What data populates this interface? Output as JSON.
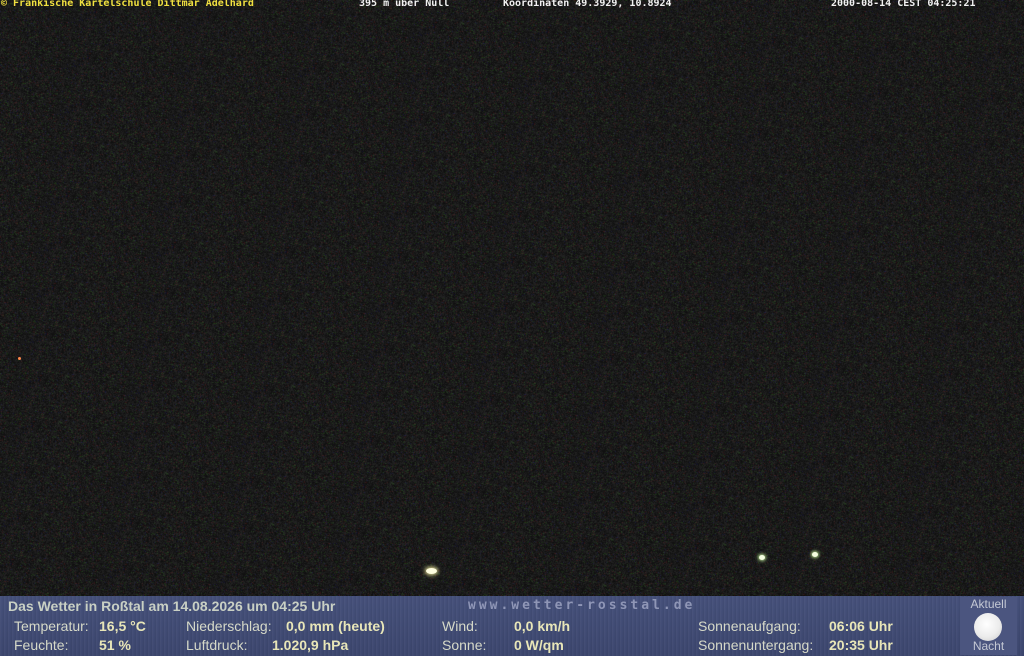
{
  "top_bar": {
    "copyright": "© Fränkische Kartelschule Dittmar Adelhard",
    "altitude": "395 m über Null",
    "coordinates": "Koordinaten 49.3929, 10.8924",
    "timestamp": "2000-08-14 CEST 04:25:21"
  },
  "panel": {
    "title": "Das Wetter in Roßtal am 14.08.2026 um 04:25 Uhr",
    "url": "www.wetter-rosstal.de",
    "temperature": {
      "label": "Temperatur:",
      "value": "16,5 °C"
    },
    "humidity": {
      "label": "Feuchte:",
      "value": "51 %"
    },
    "precipitation": {
      "label": "Niederschlag:",
      "value": "0,0 mm (heute)"
    },
    "pressure": {
      "label": "Luftdruck:",
      "value": "1.020,9 hPa"
    },
    "wind": {
      "label": "Wind:",
      "value": "0,0 km/h"
    },
    "sun": {
      "label": "Sonne:",
      "value": "0 W/qm"
    },
    "sunrise": {
      "label": "Sonnenaufgang:",
      "value": "06:06 Uhr"
    },
    "sunset": {
      "label": "Sonnenuntergang:",
      "value": "20:35 Uhr"
    },
    "moon": {
      "current_label": "Aktuell",
      "icon": "moon-icon",
      "state_label": "Nacht"
    }
  },
  "colors": {
    "sky": "#141414",
    "panel_bg": "#45507a",
    "copyright": "#f0e040",
    "value_text": "#e8e6b8"
  }
}
